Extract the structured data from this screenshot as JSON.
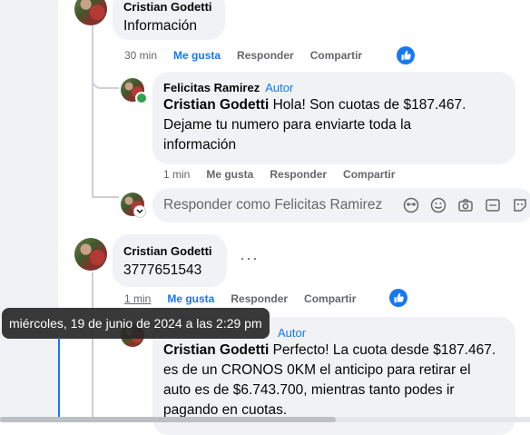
{
  "comments": [
    {
      "author": "Cristian Godetti",
      "text": "Información",
      "time": "30 min",
      "like": "Me gusta",
      "reply": "Responder",
      "share": "Compartir"
    },
    {
      "author": "Felicitas Ramirez",
      "badge": "Autor",
      "mention": "Cristian Godetti",
      "line1": " Hola! Son cuotas de $187.467.",
      "line2": "Dejame tu numero para enviarte toda la",
      "line3": "información",
      "time": "1 min",
      "like": "Me gusta",
      "reply": "Responder",
      "share": "Compartir"
    },
    {
      "author": "Cristian Godetti",
      "text": "3777651543",
      "time": "1 min",
      "like": "Me gusta",
      "reply": "Responder",
      "share": "Compartir"
    },
    {
      "badge": "Autor",
      "mention": "Cristian Godetti",
      "line1": " Perfecto! La cuota desde $187.467.",
      "line2": "es de un CRONOS 0KM el anticipo para retirar el",
      "line3": "auto es de $6.743.700, mientras tanto podes ir",
      "line4": "pagando en cuotas."
    }
  ],
  "reply_box": {
    "placeholder": "Responder como Felicitas Ramirez"
  },
  "tooltip": {
    "text": "miércoles, 19 de junio de 2024 a las 2:29 pm"
  },
  "colors": {
    "accent": "#1877f2",
    "bubble": "#f0f2f5",
    "online": "#31a24c"
  },
  "icons": [
    "like-reaction-icon",
    "gif-sticker-icon",
    "emoji-icon",
    "camera-icon",
    "gif-icon",
    "sticker-icon",
    "more-options-icon"
  ]
}
